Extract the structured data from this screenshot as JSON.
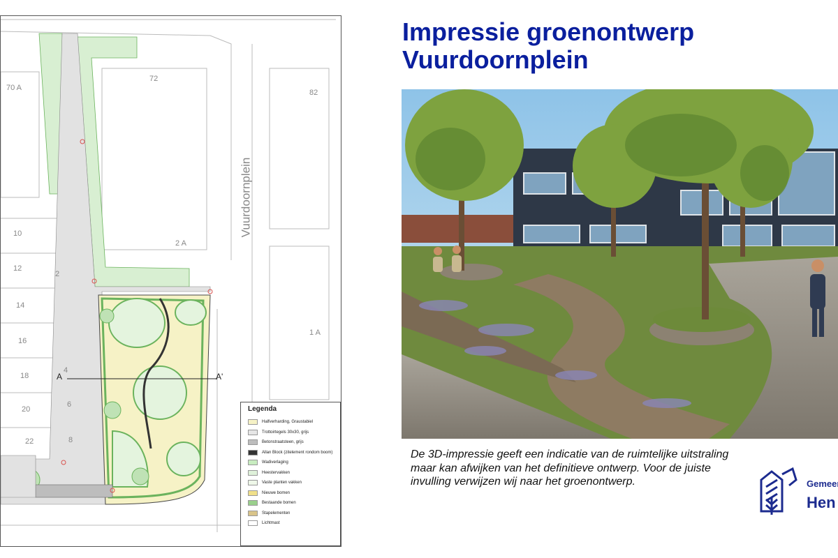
{
  "title_line1": "Impressie groenontwerp",
  "title_line2": "Vuurdoornplein",
  "caption": "De 3D-impressie geeft een indicatie van de ruimtelijke uitstraling maar kan afwijken van het definitieve ontwerp. Voor de juiste invulling verwijzen wij naar het groenontwerp.",
  "plan": {
    "street_label": "Vuurdoornplein",
    "house_numbers": [
      "70 A",
      "72",
      "82",
      "10",
      "12",
      "14",
      "16",
      "18",
      "20",
      "22",
      "2",
      "4",
      "6",
      "8",
      "2 A",
      "1 A"
    ],
    "section_start": "A",
    "section_end": "A'",
    "legend": {
      "title": "Legenda",
      "items": [
        {
          "label": "Halfverharding, Graustabiel",
          "color": "#f6f2c6"
        },
        {
          "label": "Trottoirtegels 30x30, grijs",
          "color": "#e6e6e6"
        },
        {
          "label": "Betonstraatsteen, grijs",
          "color": "#bdbdbd"
        },
        {
          "label": "Allan Block (zitelement rondom boom)",
          "color": "#333333"
        },
        {
          "label": "Wadiverlaging",
          "color": "#c8ecc0"
        },
        {
          "label": "Heestervakken",
          "color": "#dff1da"
        },
        {
          "label": "Vaste planten vakken",
          "color": "#eef7e8"
        },
        {
          "label": "Nieuwe bomen",
          "color": "#f0e08a"
        },
        {
          "label": "Bestaande bomen",
          "color": "#9ad08c"
        },
        {
          "label": "Stapelementen",
          "color": "#d9c48a"
        },
        {
          "label": "Lichtmast",
          "color": "#ffffff"
        }
      ]
    }
  },
  "logo": {
    "line1": "Gemeente",
    "line2": "Hen"
  },
  "colors": {
    "title": "#0a1f9e",
    "logo": "#1c2b8f"
  }
}
